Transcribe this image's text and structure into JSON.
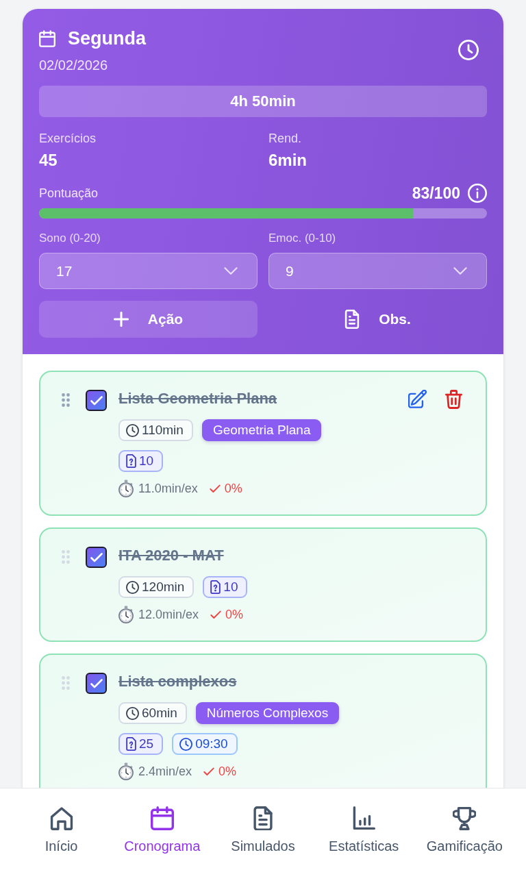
{
  "header": {
    "day": "Segunda",
    "date": "02/02/2026",
    "total_time": "4h 50min",
    "stats": [
      {
        "label": "Exercícios",
        "value": "45"
      },
      {
        "label": "Rend.",
        "value": "6min"
      }
    ],
    "score": {
      "label": "Pontuação",
      "value": "83/100",
      "level": 0.835
    },
    "selects": [
      {
        "label": "Sono (0-20)",
        "value": "17"
      },
      {
        "label": "Emoc. (0-10)",
        "value": "9"
      }
    ],
    "buttons": [
      {
        "kind": "add",
        "label": "Ação"
      },
      {
        "kind": "notes",
        "label": "Obs."
      }
    ]
  },
  "tasks": [
    {
      "title": "Lista Geometria Plana",
      "checked": true,
      "hovered": true,
      "chip_rows": [
        [
          {
            "kind": "duration",
            "text": "110min"
          },
          {
            "kind": "subject",
            "text": "Geometria Plana"
          }
        ],
        [
          {
            "kind": "exercises",
            "text": "10"
          }
        ]
      ],
      "pace": "11.0min/ex",
      "accuracy": "0%"
    },
    {
      "title": "ITA 2020 - MAT",
      "checked": true,
      "hovered": false,
      "chip_rows": [
        [
          {
            "kind": "duration",
            "text": "120min"
          },
          {
            "kind": "exercises",
            "text": "10"
          }
        ]
      ],
      "pace": "12.0min/ex",
      "accuracy": "0%"
    },
    {
      "title": "Lista complexos",
      "checked": true,
      "hovered": false,
      "chip_rows": [
        [
          {
            "kind": "duration",
            "text": "60min"
          },
          {
            "kind": "subject",
            "text": "Números Complexos"
          }
        ],
        [
          {
            "kind": "exercises",
            "text": "25"
          },
          {
            "kind": "time",
            "text": "09:30"
          }
        ]
      ],
      "pace": "2.4min/ex",
      "accuracy": "0%"
    }
  ],
  "nav": {
    "items": [
      {
        "label": "Início",
        "selected": false
      },
      {
        "label": "Cronograma",
        "selected": true
      },
      {
        "label": "Simulados",
        "selected": false
      },
      {
        "label": "Estatísticas",
        "selected": false
      },
      {
        "label": "Gamificação",
        "selected": false
      }
    ]
  }
}
